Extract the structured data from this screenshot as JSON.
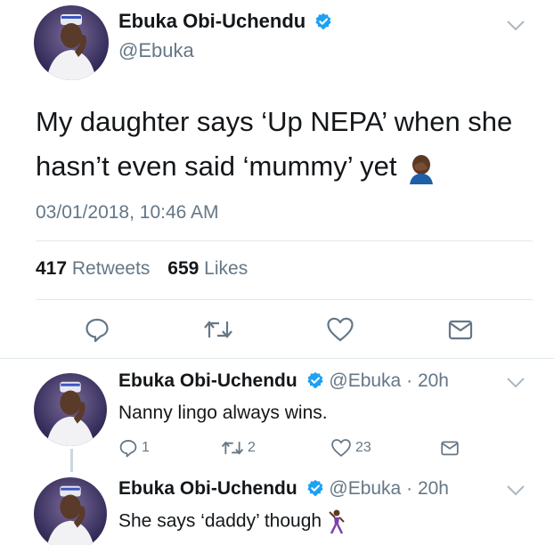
{
  "main_tweet": {
    "author_name": "Ebuka Obi-Uchendu",
    "handle": "@Ebuka",
    "text_line1": "My daughter says ‘Up NEPA’ when she",
    "text_line2": "hasn’t even said ‘mummy’ yet",
    "timestamp": "03/01/2018, 10:46 AM",
    "retweets_count": "417",
    "retweets_label": "Retweets",
    "likes_count": "659",
    "likes_label": "Likes"
  },
  "replies": [
    {
      "author_name": "Ebuka Obi-Uchendu",
      "handle": "@Ebuka",
      "separator": "·",
      "time": "20h",
      "text": "Nanny lingo always wins.",
      "reply_count": "1",
      "retweet_count": "2",
      "like_count": "23"
    },
    {
      "author_name": "Ebuka Obi-Uchendu",
      "handle": "@Ebuka",
      "separator": "·",
      "time": "20h",
      "text": "She says ‘daddy’ though"
    }
  ],
  "colors": {
    "verified": "#1da1f2",
    "secondary_text": "#657786",
    "primary_text": "#14171a",
    "divider": "#e1e8ed"
  },
  "icons": {
    "verified": "verified-badge-icon",
    "chevron": "chevron-down-icon",
    "reply": "reply-icon",
    "retweet": "retweet-icon",
    "like": "heart-icon",
    "message": "direct-message-icon",
    "facepalm": "facepalm-emoji-icon",
    "dancer": "dancing-man-emoji-icon"
  }
}
